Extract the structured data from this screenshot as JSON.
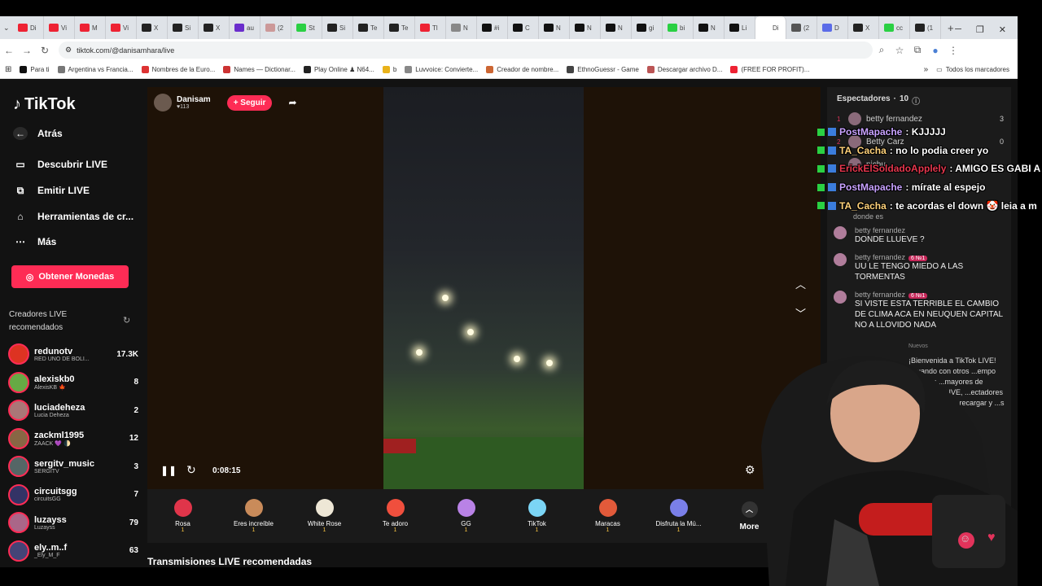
{
  "browser": {
    "tabs": [
      "Di",
      "Vi",
      "M",
      "Vi",
      "X",
      "Si",
      "X",
      "au",
      "(2",
      "St",
      "Si",
      "Te",
      "Te",
      "Tl",
      "N",
      "#i",
      "C",
      "N",
      "N",
      "N",
      "gi",
      "bi",
      "N",
      "Li",
      "Di",
      "(2",
      "D",
      "X",
      "cc",
      "(1"
    ],
    "url": "tiktok.com/@danisamhara/live",
    "bookmarks": [
      "Para ti",
      "Argentina vs Francia...",
      "Nombres de la Euro...",
      "Names — Dictionar...",
      "Play Online ♟ N64...",
      "b",
      "Luvvoice: Convierte...",
      "Creador de nombre...",
      "EthnoGuessr - Game",
      "Descargar archivo D...",
      "(FREE FOR PROFIT)..."
    ],
    "all_bookmarks": "Todos los marcadores",
    "more_bookmarks": "»"
  },
  "sidebar": {
    "logo": "TikTok",
    "nav": [
      "Atrás",
      "Descubrir LIVE",
      "Emitir LIVE",
      "Herramientas de cr...",
      "Más"
    ],
    "coins": "Obtener Monedas",
    "rec_title": "Creadores LIVE recomendados",
    "creators": [
      {
        "name": "redunotv",
        "sub": "RED UNO DE BOLI...",
        "count": "17.3K"
      },
      {
        "name": "alexiskb0",
        "sub": "AlexisKB 🍁",
        "count": "8"
      },
      {
        "name": "luciadeheza",
        "sub": "Lucia Deheza",
        "count": "2"
      },
      {
        "name": "zackml1995",
        "sub": "ZAACK 💜 🌓",
        "count": "12"
      },
      {
        "name": "sergitv_music",
        "sub": "SERGITV",
        "count": "3"
      },
      {
        "name": "circuitsgg",
        "sub": "circuitsGG",
        "count": "7"
      },
      {
        "name": "luzayss",
        "sub": "Luzayss",
        "count": "79"
      },
      {
        "name": "ely..m..f",
        "sub": "_Ely_M_F",
        "count": "63"
      }
    ]
  },
  "stream": {
    "host": "Danisam",
    "likes": "♥113",
    "follow": "+ Seguir",
    "time": "0:08:15",
    "recommended": "Transmisiones LIVE recomendadas"
  },
  "gifts": [
    {
      "name": "Rosa",
      "cost": "1",
      "color": "#e0354a"
    },
    {
      "name": "Eres increíble",
      "cost": "1",
      "color": "#c98b5a"
    },
    {
      "name": "White Rose",
      "cost": "1",
      "color": "#eee7d6"
    },
    {
      "name": "Te adoro",
      "cost": "1",
      "color": "#f04f3d"
    },
    {
      "name": "GG",
      "cost": "1",
      "color": "#b982e6"
    },
    {
      "name": "TikTok",
      "cost": "1",
      "color": "#7bd5f5"
    },
    {
      "name": "Maracas",
      "cost": "1",
      "color": "#e25a3a"
    },
    {
      "name": "Disfruta la Mú...",
      "cost": "1",
      "color": "#7a7fe8"
    }
  ],
  "gifts_more": "More",
  "chat": {
    "viewers_title": "Espectadores",
    "viewers_count": "10",
    "viewers": [
      {
        "rank": "1",
        "name": "betty fernandez",
        "n": "3"
      },
      {
        "rank": "2",
        "name": "Betty Carz",
        "n": "0"
      },
      {
        "rank": "",
        "name": "pichu",
        "n": ""
      }
    ],
    "partial": "donde es",
    "messages": [
      {
        "name": "betty fernandez",
        "text": "DONDE LLUEVE ?",
        "badge": ""
      },
      {
        "name": "betty fernandez",
        "text": "UU LE TENGO MIEDO A LAS TORMENTAS",
        "badge": "6 №1"
      },
      {
        "name": "betty fernandez",
        "text": "SI VISTE ESTA TERRIBLE EL CAMBIO DE CLIMA ACA EN NEUQUEN CAPITAL NO A LLOVIDO NADA",
        "badge": "6 №1"
      }
    ],
    "new_label": "Nuevos",
    "welcome": "¡Bienvenida a TikTok LIVE! ...tuando con otros ...empo real. Los ...mayores de ...emitir un LIVE, ...ectadores deben ...s para recargar y ...s de seguir"
  },
  "overlay": [
    {
      "name": "PostMapache",
      "text": ": KJJJJJ",
      "color": "#c8a2ff"
    },
    {
      "name": "TA_Cacha",
      "text": ": no lo podia creer yo",
      "color": "#ffd27a"
    },
    {
      "name": "ErickElSoldadoApplely",
      "text": ": AMIGO ES GABI A L",
      "color": "#e6374e"
    },
    {
      "name": "PostMapache",
      "text": ": mírate al espejo",
      "color": "#c8a2ff"
    },
    {
      "name": "TA_Cacha",
      "text": ": te acordas el down 🤡 leia a m",
      "color": "#ffd27a"
    }
  ]
}
